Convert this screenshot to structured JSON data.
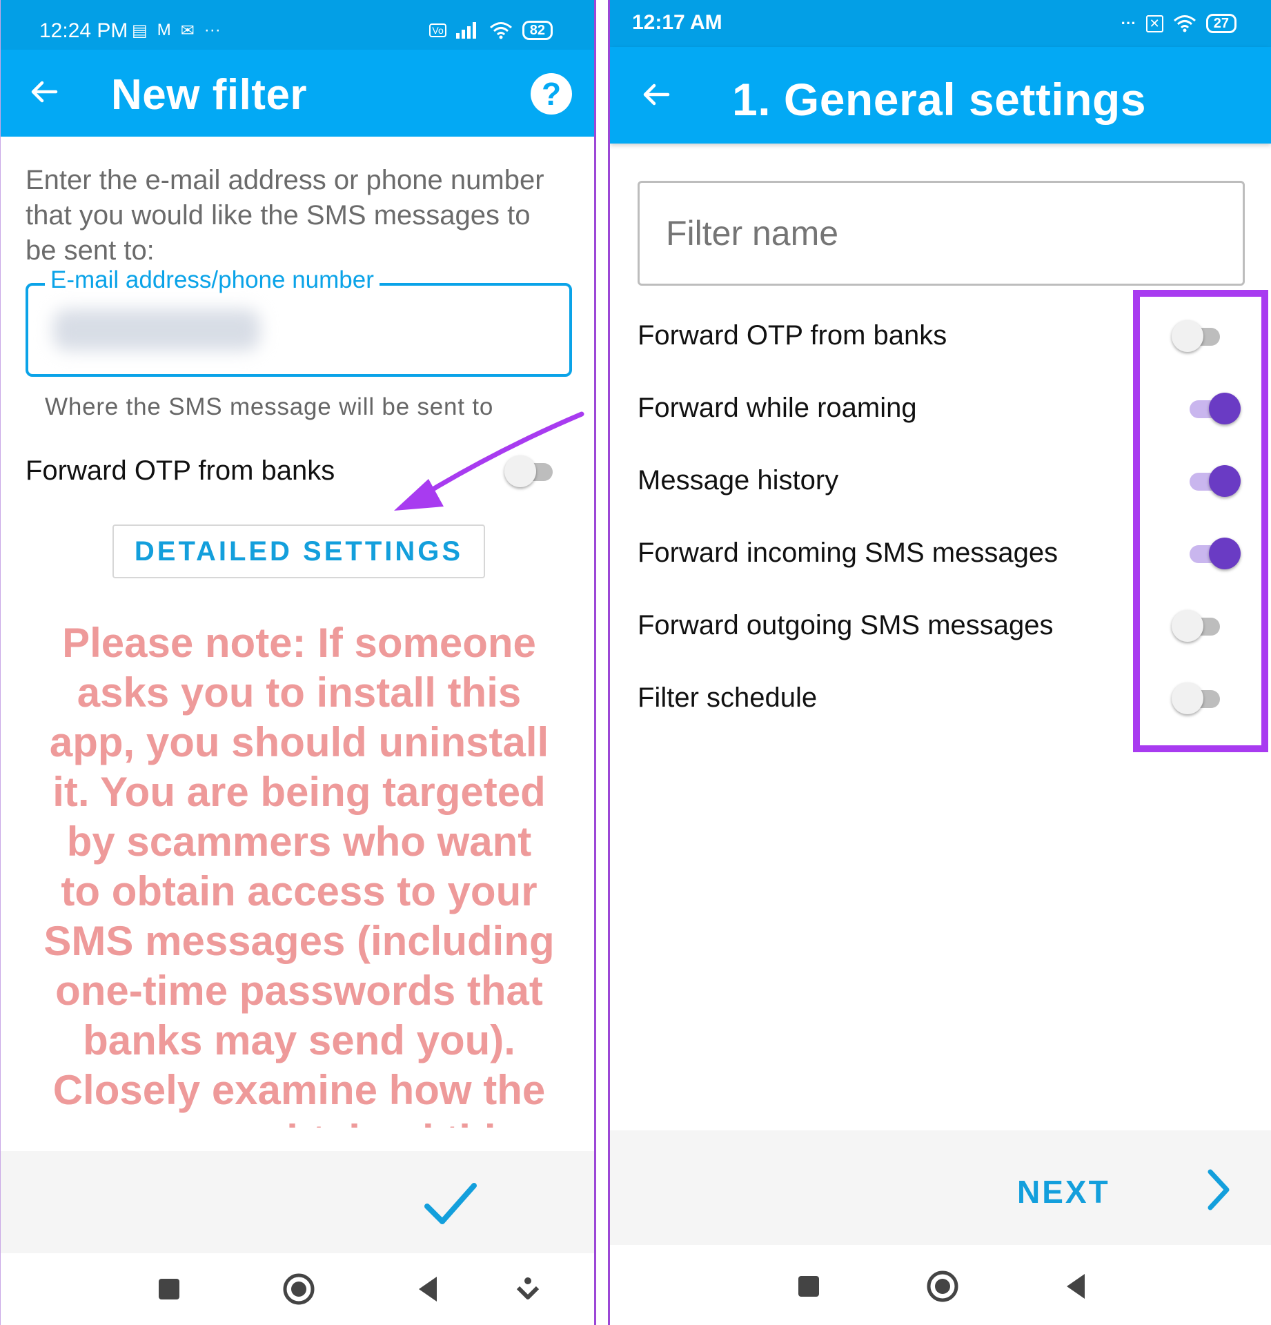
{
  "left_phone": {
    "status": {
      "time": "12:24 PM",
      "battery": "82"
    },
    "appbar": {
      "title": "New filter",
      "help_glyph": "?"
    },
    "intro": "Enter the e-mail address or phone number that you would like the SMS messages to be sent to:",
    "field": {
      "label": "E-mail address/phone number",
      "value_blurred": "**********"
    },
    "helper": "Where the SMS message will be sent to",
    "otp": {
      "label": "Forward OTP from banks",
      "enabled": false
    },
    "detailed_settings": "DETAILED SETTINGS",
    "warning": "Please note: If someone asks you to install this app, you should uninstall it. You are being targeted by scammers who want to obtain access to your SMS messages (including one-time passwords that banks may send you). Closely examine how the scammers obtained this..."
  },
  "right_phone": {
    "status": {
      "time": "12:17 AM",
      "battery": "27"
    },
    "appbar": {
      "title": "1. General settings"
    },
    "filter_name_placeholder": "Filter name",
    "settings": [
      {
        "label": "Forward OTP from banks",
        "enabled": false
      },
      {
        "label": "Forward while roaming",
        "enabled": true
      },
      {
        "label": "Message history",
        "enabled": true
      },
      {
        "label": "Forward incoming SMS messages",
        "enabled": true
      },
      {
        "label": "Forward outgoing SMS messages",
        "enabled": false
      },
      {
        "label": "Filter schedule",
        "enabled": false
      }
    ],
    "next": "NEXT"
  },
  "colors": {
    "appbar": "#03a9f4",
    "statusbar": "#039fe6",
    "accent": "#139fdc",
    "warning_text": "#ee9a9a",
    "switch_on": "#6a3bc4",
    "annotation": "#a83bf0"
  },
  "icons": [
    "back-arrow-icon",
    "help-icon",
    "checkmark-icon",
    "chevron-right-icon",
    "nav-square-icon",
    "nav-home-icon",
    "nav-back-icon",
    "nav-down-icon",
    "wifi-icon",
    "signal-icon",
    "battery-icon",
    "gmail-icon",
    "mail-icon"
  ]
}
